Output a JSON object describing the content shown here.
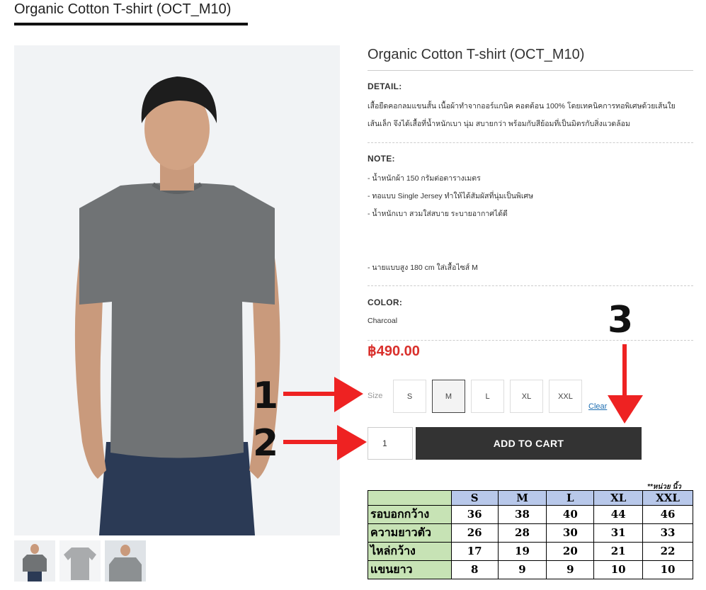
{
  "page": {
    "title": "Organic Cotton T-shirt (OCT_M10)"
  },
  "product": {
    "title": "Organic Cotton T-shirt (OCT_M10)",
    "detail_label": "DETAIL:",
    "detail_lines": [
      "เสื้อยืดคอกลมแขนสั้น เนื้อผ้าทำจากออร์แกนิค คอตต้อน 100% โดยเทคนิคการทอพิเศษด้วยเส้นใย",
      "เส้นเล็ก จึงได้เสื้อที่น้ำหนักเบา นุ่ม สบายกว่า พร้อมกับสีย้อมที่เป็นมิตรกับสิ่งแวดล้อม"
    ],
    "note_label": "NOTE:",
    "note_lines": [
      "- น้ำหนักผ้า 150 กรัมต่อตารางเมตร",
      "- ทอแบบ Single Jersey ทำให้ได้สัมผัสที่นุ่มเป็นพิเศษ",
      "- น้ำหนักเบา สวมใส่สบาย ระบายอากาศได้ดี"
    ],
    "model_note": "- นายแบบสูง 180 cm ใส่เสื้อไซส์ M",
    "color_label": "COLOR:",
    "color_value": "Charcoal",
    "price": "฿490.00",
    "size_label": "Size",
    "sizes": [
      "S",
      "M",
      "L",
      "XL",
      "XXL"
    ],
    "selected_size": "M",
    "clear_label": "Clear",
    "quantity": "1",
    "add_to_cart_label": "ADD TO CART"
  },
  "size_chart": {
    "unit_note": "**หน่วย นิ้ว",
    "headers": [
      "S",
      "M",
      "L",
      "XL",
      "XXL"
    ],
    "rows": [
      {
        "label": "รอบอกกว้าง",
        "values": [
          "36",
          "38",
          "40",
          "44",
          "46"
        ]
      },
      {
        "label": "ความยาวตัว",
        "values": [
          "26",
          "28",
          "30",
          "31",
          "33"
        ]
      },
      {
        "label": "ไหล่กว้าง",
        "values": [
          "17",
          "19",
          "20",
          "21",
          "22"
        ]
      },
      {
        "label": "แขนยาว",
        "values": [
          "8",
          "9",
          "9",
          "10",
          "10"
        ]
      }
    ]
  },
  "annotations": {
    "one": "1",
    "two": "2",
    "three": "3",
    "arrow_color": "#ee2222"
  },
  "colors": {
    "price": "#d9302c",
    "cart_button": "#333333",
    "chart_header": "#b8c8ea",
    "chart_label": "#c7e3b5"
  }
}
